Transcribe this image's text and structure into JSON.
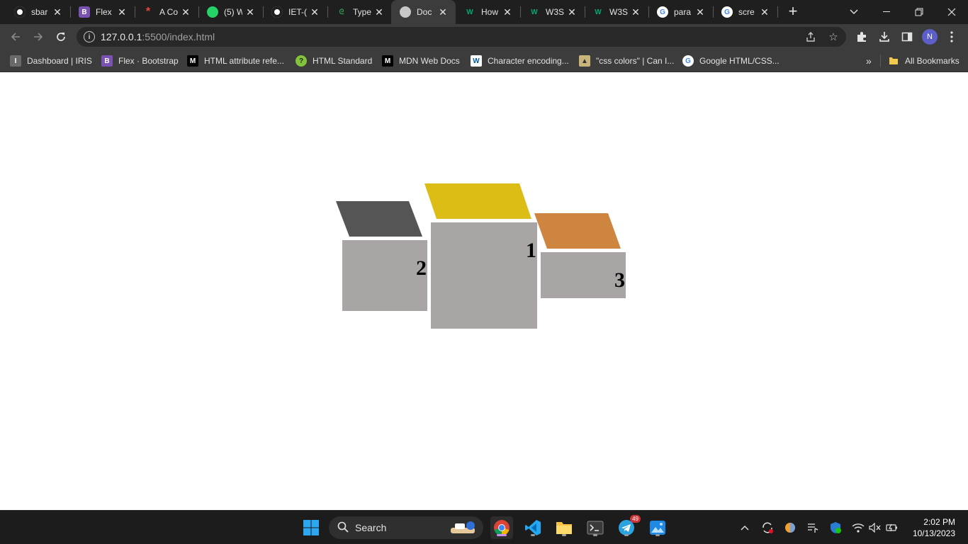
{
  "browser": {
    "tabs": [
      {
        "title": "sbar",
        "icon": "github-icon",
        "color": "#ffffff"
      },
      {
        "title": "Flex",
        "icon": "bootstrap-icon",
        "color": "#7952b3"
      },
      {
        "title": "A Co",
        "icon": "asterisk-icon",
        "color": "#e8453c"
      },
      {
        "title": "(5) W",
        "icon": "whatsapp-icon",
        "color": "#25d366"
      },
      {
        "title": "IET-(",
        "icon": "github-icon",
        "color": "#ffffff"
      },
      {
        "title": "Type",
        "icon": "geeksforgeeks-icon",
        "color": "#2f8d46"
      },
      {
        "title": "Doc",
        "icon": "globe-icon",
        "color": "#c8c8c8"
      },
      {
        "title": "How",
        "icon": "w3schools-icon",
        "color": "#04aa6d"
      },
      {
        "title": "W3S",
        "icon": "w3schools-icon",
        "color": "#04aa6d"
      },
      {
        "title": "W3S",
        "icon": "w3schools-icon",
        "color": "#04aa6d"
      },
      {
        "title": "para",
        "icon": "google-icon",
        "color": "#4285f4"
      },
      {
        "title": "scre",
        "icon": "google-icon",
        "color": "#4285f4"
      }
    ],
    "active_tab": 6,
    "address_host": "127.0.0.1",
    "address_rest": ":5500/index.html",
    "profile_initial": "N",
    "bookmarks": [
      {
        "label": "Dashboard | IRIS",
        "icon": "iris-icon"
      },
      {
        "label": "Flex · Bootstrap",
        "icon": "bootstrap-icon"
      },
      {
        "label": "HTML attribute refe...",
        "icon": "mdn-icon"
      },
      {
        "label": "HTML Standard",
        "icon": "whatwg-icon"
      },
      {
        "label": "MDN Web Docs",
        "icon": "mdn-icon"
      },
      {
        "label": "Character encoding...",
        "icon": "w3c-icon"
      },
      {
        "label": "\"css colors\" | Can I...",
        "icon": "caniuse-icon"
      },
      {
        "label": "Google HTML/CSS...",
        "icon": "google-icon"
      }
    ],
    "bookmarks_more": "»",
    "all_bookmarks": "All Bookmarks"
  },
  "podium": {
    "first": {
      "rank": "1",
      "color": "#dcbd15"
    },
    "second": {
      "rank": "2",
      "color": "#555555"
    },
    "third": {
      "rank": "3",
      "color": "#cd853f"
    },
    "block_color": "#a8a5a4"
  },
  "taskbar": {
    "search_label": "Search",
    "telegram_badge": "49",
    "time": "2:02 PM",
    "date": "10/13/2023"
  }
}
